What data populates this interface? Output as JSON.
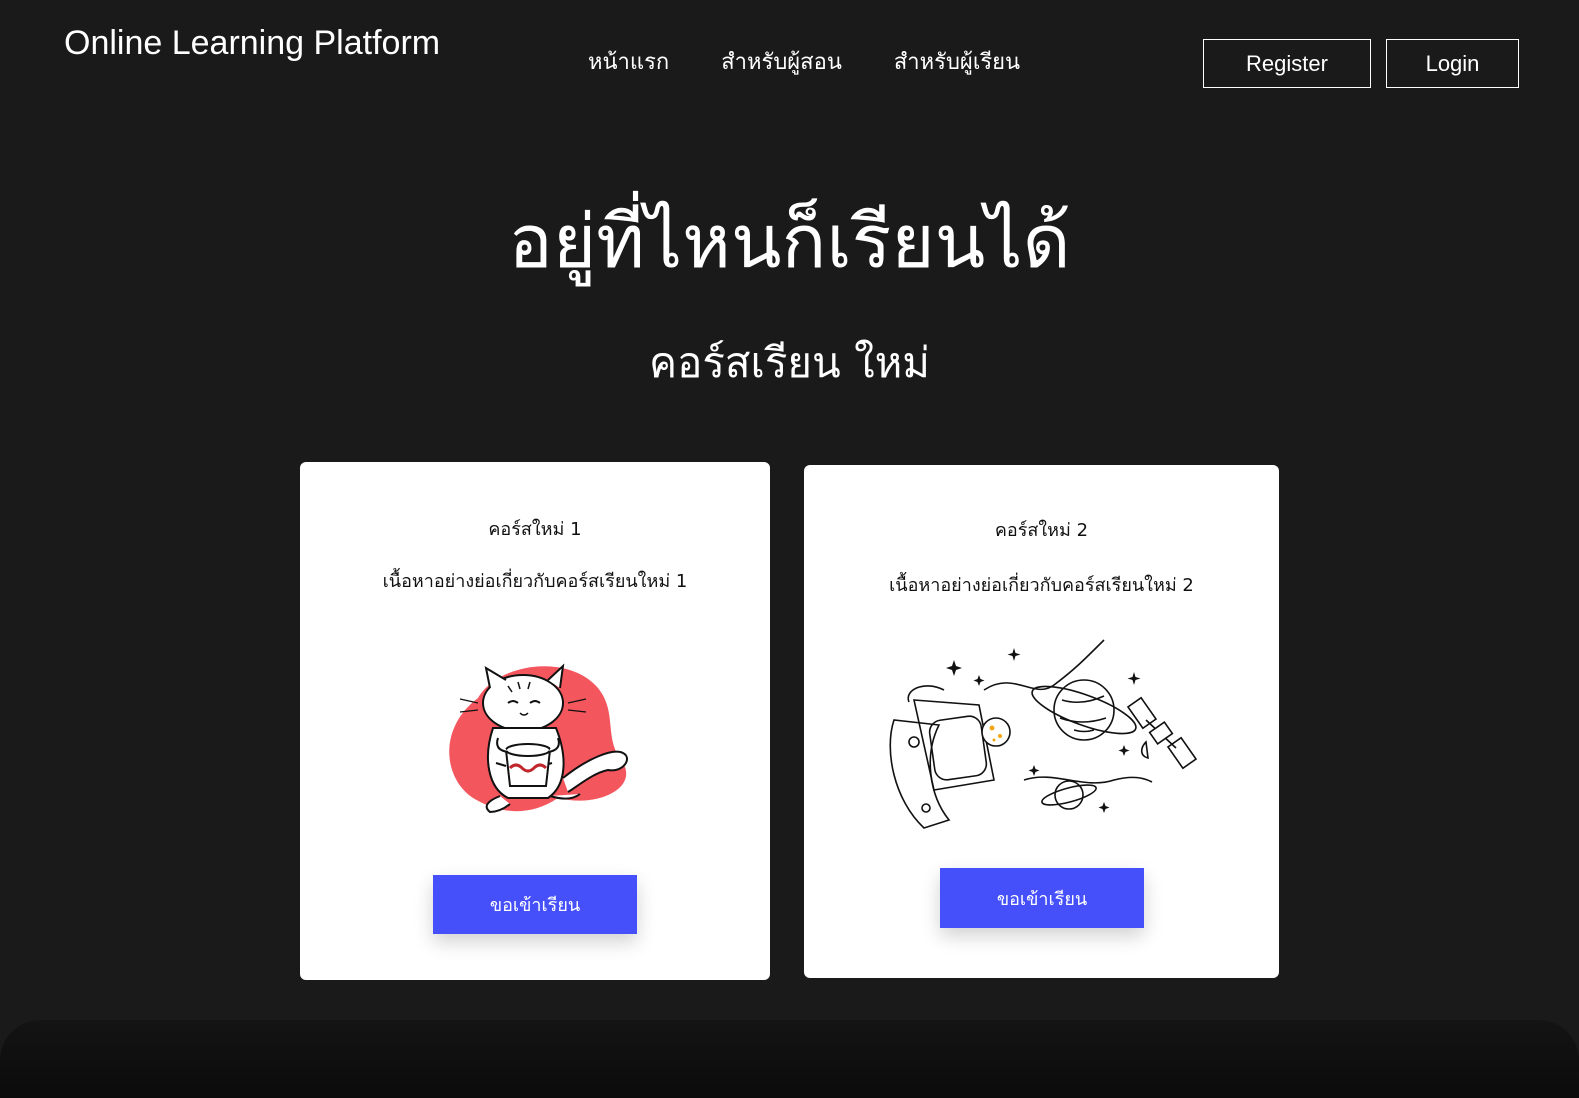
{
  "header": {
    "brand": "Online Learning Platform",
    "nav": [
      "หน้าแรก",
      "สำหรับผู้สอน",
      "สำหรับผู้เรียน"
    ],
    "register_label": "Register",
    "login_label": "Login"
  },
  "hero": {
    "title": "อยู่ที่ไหนก็เรียนได้",
    "subtitle": "คอร์สเรียน ใหม่"
  },
  "courses": [
    {
      "title": "คอร์สใหม่ 1",
      "description": "เนื้อหาอย่างย่อเกี่ยวกับคอร์สเรียนใหม่ 1",
      "button_label": "ขอเข้าเรียน",
      "illustration": "cat-holding-drum"
    },
    {
      "title": "คอร์สใหม่ 2",
      "description": "เนื้อหาอย่างย่อเกี่ยวกับคอร์สเรียนใหม่ 2",
      "button_label": "ขอเข้าเรียน",
      "illustration": "smartwatch-planets-satellite"
    }
  ],
  "colors": {
    "background": "#1a1a1a",
    "accent": "#4550fa",
    "blob": "#f4565e"
  }
}
